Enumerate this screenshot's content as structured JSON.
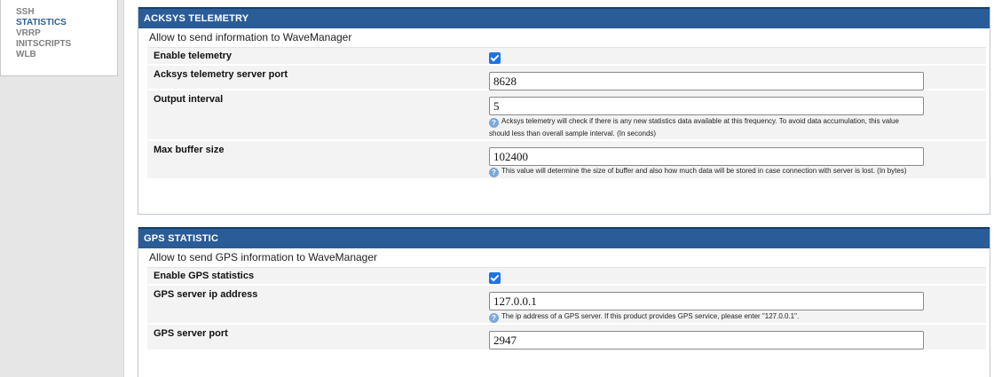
{
  "sidebar": {
    "items": [
      {
        "label": "SSH"
      },
      {
        "label": "STATISTICS"
      },
      {
        "label": "VRRP"
      },
      {
        "label": "INITSCRIPTS"
      },
      {
        "label": "WLB"
      }
    ],
    "active": "STATISTICS"
  },
  "acksys": {
    "title": "ACKSYS TELEMETRY",
    "description": "Allow to send information to WaveManager",
    "enable": {
      "label": "Enable telemetry",
      "checked": true
    },
    "port": {
      "label": "Acksys telemetry server port",
      "value": "8628"
    },
    "interval": {
      "label": "Output interval",
      "value": "5",
      "help_line1": "Acksys telemetry will check if there is any new statistics data available at this frequency. To avoid data accumulation, this value",
      "help_line2": "should less than overall sample interval. (In seconds)"
    },
    "buffer": {
      "label": "Max buffer size",
      "value": "102400",
      "help": "This value will determine the size of buffer and also how much data will be stored in case connection with server is lost. (In bytes)"
    }
  },
  "gps": {
    "title": "GPS STATISTIC",
    "description": "Allow to send GPS information to WaveManager",
    "enable": {
      "label": "Enable GPS statistics",
      "checked": true
    },
    "ip": {
      "label": "GPS server ip address",
      "value": "127.0.0.1",
      "help": "The ip address of a GPS server. If this product provides GPS service, please enter \"127.0.0.1\"."
    },
    "port": {
      "label": "GPS server port",
      "value": "2947"
    }
  },
  "icons": {
    "help": "help-icon",
    "checkbox": "checkbox-checked"
  },
  "colors": {
    "header": "#2a5c97",
    "checkbox": "#1a73e8",
    "active_menu": "#2d5f96"
  }
}
